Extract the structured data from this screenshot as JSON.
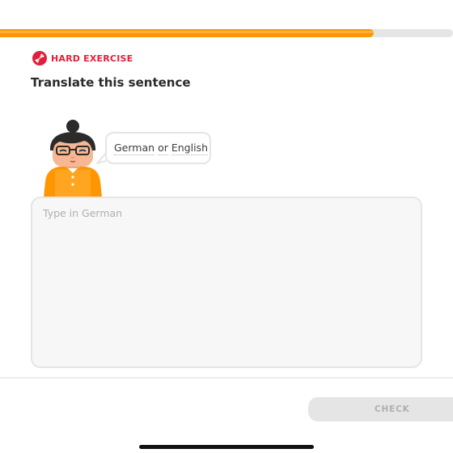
{
  "progress": {
    "fraction": 0.825,
    "fill_color": "#ff9600",
    "track_color": "#e5e5e5"
  },
  "badge": {
    "label": "HARD EXERCISE",
    "icon": "dumbbell-icon",
    "color": "#e0203a"
  },
  "title": "Translate this sentence",
  "character": {
    "icon": "character-avatar"
  },
  "prompt": {
    "words": [
      "German",
      "or",
      "English"
    ]
  },
  "answer": {
    "value": "",
    "placeholder": "Type in German"
  },
  "footer": {
    "check_label": "CHECK"
  }
}
